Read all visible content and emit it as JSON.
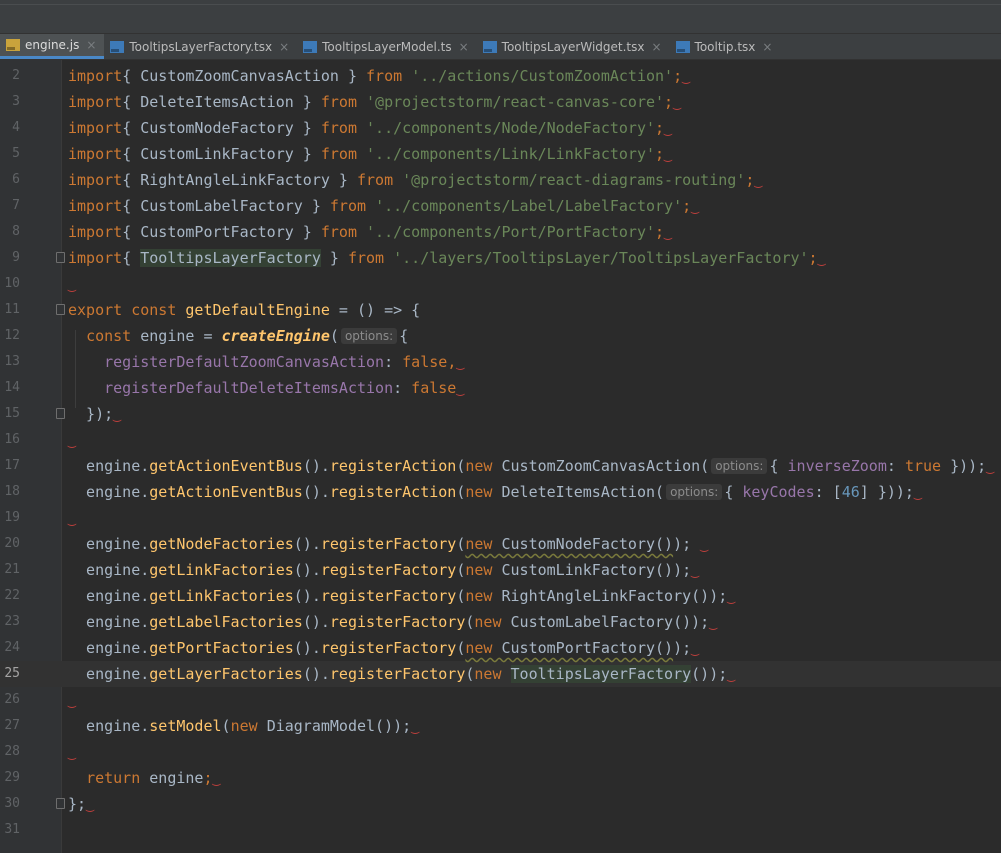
{
  "tabs": [
    {
      "label": "engine.js",
      "icon": "js-file-icon",
      "type": "js",
      "active": true
    },
    {
      "label": "TooltipsLayerFactory.tsx",
      "icon": "tsx-file-icon",
      "type": "tsx",
      "active": false
    },
    {
      "label": "TooltipsLayerModel.ts",
      "icon": "ts-file-icon",
      "type": "ts",
      "active": false
    },
    {
      "label": "TooltipsLayerWidget.tsx",
      "icon": "tsx-file-icon",
      "type": "tsx",
      "active": false
    },
    {
      "label": "Tooltip.tsx",
      "icon": "tsx-file-icon",
      "type": "tsx",
      "active": false
    }
  ],
  "tab_close_glyph": "×",
  "current_line": 25,
  "lines": [
    {
      "num": "2",
      "tokens": [
        [
          "k",
          "import"
        ],
        [
          "",
          "{ CustomZoomCanvasAction } "
        ],
        [
          "k",
          "from"
        ],
        [
          "",
          " "
        ],
        [
          "s",
          "'../actions/CustomZoomAction'"
        ],
        [
          "k",
          ";"
        ],
        [
          "sq",
          "‿"
        ]
      ]
    },
    {
      "num": "3",
      "tokens": [
        [
          "k",
          "import"
        ],
        [
          "",
          "{ DeleteItemsAction } "
        ],
        [
          "k",
          "from"
        ],
        [
          "",
          " "
        ],
        [
          "s",
          "'@projectstorm/react-canvas-core'"
        ],
        [
          "k",
          ";"
        ],
        [
          "sq",
          "‿"
        ]
      ]
    },
    {
      "num": "4",
      "tokens": [
        [
          "k",
          "import"
        ],
        [
          "",
          "{ CustomNodeFactory } "
        ],
        [
          "k",
          "from"
        ],
        [
          "",
          " "
        ],
        [
          "s",
          "'../components/Node/NodeFactory'"
        ],
        [
          "k",
          ";"
        ],
        [
          "sq",
          "‿"
        ]
      ]
    },
    {
      "num": "5",
      "tokens": [
        [
          "k",
          "import"
        ],
        [
          "",
          "{ CustomLinkFactory } "
        ],
        [
          "k",
          "from"
        ],
        [
          "",
          " "
        ],
        [
          "s",
          "'../components/Link/LinkFactory'"
        ],
        [
          "k",
          ";"
        ],
        [
          "sq",
          "‿"
        ]
      ]
    },
    {
      "num": "6",
      "tokens": [
        [
          "k",
          "import"
        ],
        [
          "",
          "{ RightAngleLinkFactory } "
        ],
        [
          "k",
          "from"
        ],
        [
          "",
          " "
        ],
        [
          "s",
          "'@projectstorm/react-diagrams-routing'"
        ],
        [
          "k",
          ";"
        ],
        [
          "sq",
          "‿"
        ]
      ]
    },
    {
      "num": "7",
      "tokens": [
        [
          "k",
          "import"
        ],
        [
          "",
          "{ CustomLabelFactory } "
        ],
        [
          "k",
          "from"
        ],
        [
          "",
          " "
        ],
        [
          "s",
          "'../components/Label/LabelFactory'"
        ],
        [
          "k",
          ";"
        ],
        [
          "sq",
          "‿"
        ]
      ]
    },
    {
      "num": "8",
      "tokens": [
        [
          "k",
          "import"
        ],
        [
          "",
          "{ CustomPortFactory } "
        ],
        [
          "k",
          "from"
        ],
        [
          "",
          " "
        ],
        [
          "s",
          "'../components/Port/PortFactory'"
        ],
        [
          "k",
          ";"
        ],
        [
          "sq",
          "‿"
        ]
      ]
    },
    {
      "num": "9",
      "tokens": [
        [
          "k",
          "import"
        ],
        [
          "",
          "{ "
        ],
        [
          "hlid",
          "TooltipsLayerFactory"
        ],
        [
          "",
          " } "
        ],
        [
          "k",
          "from"
        ],
        [
          "",
          " "
        ],
        [
          "s",
          "'../layers/TooltipsLayer/TooltipsLayerFactory'"
        ],
        [
          "k",
          ";"
        ],
        [
          "sq",
          "‿"
        ]
      ]
    },
    {
      "num": "10",
      "tokens": [
        [
          "sq",
          "‿"
        ]
      ]
    },
    {
      "num": "11",
      "tokens": [
        [
          "k",
          "export const "
        ],
        [
          "f",
          "getDefaultEngine"
        ],
        [
          "",
          " = () => {"
        ]
      ]
    },
    {
      "num": "12",
      "tokens": [
        [
          "",
          "  "
        ],
        [
          "k",
          "const "
        ],
        [
          "",
          "engine = "
        ],
        [
          "fi",
          "createEngine"
        ],
        [
          "",
          "("
        ],
        [
          "hint",
          "options:"
        ],
        [
          "",
          "{"
        ]
      ]
    },
    {
      "num": "13",
      "tokens": [
        [
          "",
          "    "
        ],
        [
          "p",
          "registerDefaultZoomCanvasAction"
        ],
        [
          "",
          ": "
        ],
        [
          "k",
          "false"
        ],
        [
          "k",
          ","
        ],
        [
          "sq",
          "‿"
        ]
      ]
    },
    {
      "num": "14",
      "tokens": [
        [
          "",
          "    "
        ],
        [
          "p",
          "registerDefaultDeleteItemsAction"
        ],
        [
          "",
          ": "
        ],
        [
          "k",
          "false"
        ],
        [
          "sq",
          "‿"
        ]
      ]
    },
    {
      "num": "15",
      "tokens": [
        [
          "",
          "  });"
        ],
        [
          "sq",
          "‿"
        ]
      ]
    },
    {
      "num": "16",
      "tokens": [
        [
          "sq",
          "‿"
        ]
      ]
    },
    {
      "num": "17",
      "tokens": [
        [
          "",
          "  engine."
        ],
        [
          "f",
          "getActionEventBus"
        ],
        [
          "",
          "()."
        ],
        [
          "f",
          "registerAction"
        ],
        [
          "",
          "("
        ],
        [
          "k",
          "new "
        ],
        [
          "",
          "CustomZoomCanvasAction("
        ],
        [
          "hint",
          "options:"
        ],
        [
          "",
          "{ "
        ],
        [
          "p",
          "inverseZoom"
        ],
        [
          "",
          ": "
        ],
        [
          "k",
          "true"
        ],
        [
          "",
          " }));"
        ],
        [
          "sq",
          "‿"
        ]
      ]
    },
    {
      "num": "18",
      "tokens": [
        [
          "",
          "  engine."
        ],
        [
          "f",
          "getActionEventBus"
        ],
        [
          "",
          "()."
        ],
        [
          "f",
          "registerAction"
        ],
        [
          "",
          "("
        ],
        [
          "k",
          "new "
        ],
        [
          "",
          "DeleteItemsAction("
        ],
        [
          "hint",
          "options:"
        ],
        [
          "",
          "{ "
        ],
        [
          "p",
          "keyCodes"
        ],
        [
          "",
          ": ["
        ],
        [
          "n",
          "46"
        ],
        [
          "",
          "] }));"
        ],
        [
          "sq",
          "‿"
        ]
      ]
    },
    {
      "num": "19",
      "tokens": [
        [
          "sq",
          "‿"
        ]
      ]
    },
    {
      "num": "20",
      "tokens": [
        [
          "",
          "  engine."
        ],
        [
          "f",
          "getNodeFactories"
        ],
        [
          "",
          "()."
        ],
        [
          "f",
          "registerFactory"
        ],
        [
          "",
          "("
        ],
        [
          "uwk",
          "new "
        ],
        [
          "uw",
          "CustomNodeFactory()"
        ],
        [
          "",
          "); "
        ],
        [
          "sq",
          "‿"
        ]
      ]
    },
    {
      "num": "21",
      "tokens": [
        [
          "",
          "  engine."
        ],
        [
          "f",
          "getLinkFactories"
        ],
        [
          "",
          "()."
        ],
        [
          "f",
          "registerFactory"
        ],
        [
          "",
          "("
        ],
        [
          "k",
          "new "
        ],
        [
          "",
          "CustomLinkFactory());"
        ],
        [
          "sq",
          "‿"
        ]
      ]
    },
    {
      "num": "22",
      "tokens": [
        [
          "",
          "  engine."
        ],
        [
          "f",
          "getLinkFactories"
        ],
        [
          "",
          "()."
        ],
        [
          "f",
          "registerFactory"
        ],
        [
          "",
          "("
        ],
        [
          "k",
          "new "
        ],
        [
          "",
          "RightAngleLinkFactory());"
        ],
        [
          "sq",
          "‿"
        ]
      ]
    },
    {
      "num": "23",
      "tokens": [
        [
          "",
          "  engine."
        ],
        [
          "f",
          "getLabelFactories"
        ],
        [
          "",
          "()."
        ],
        [
          "f",
          "registerFactory"
        ],
        [
          "",
          "("
        ],
        [
          "k",
          "new "
        ],
        [
          "",
          "CustomLabelFactory());"
        ],
        [
          "sq",
          "‿"
        ]
      ]
    },
    {
      "num": "24",
      "tokens": [
        [
          "",
          "  engine."
        ],
        [
          "f",
          "getPortFactories"
        ],
        [
          "",
          "()."
        ],
        [
          "f",
          "registerFactory"
        ],
        [
          "",
          "("
        ],
        [
          "uwk",
          "new "
        ],
        [
          "uw",
          "CustomPortFactory()"
        ],
        [
          "",
          ");"
        ],
        [
          "sq",
          "‿"
        ]
      ]
    },
    {
      "num": "25",
      "tokens": [
        [
          "",
          "  engine."
        ],
        [
          "f",
          "getLayerFactories"
        ],
        [
          "",
          "()."
        ],
        [
          "f",
          "registerFactory"
        ],
        [
          "",
          "("
        ],
        [
          "k",
          "new "
        ],
        [
          "hlid",
          "TooltipsLayerFactory"
        ],
        [
          "",
          "());"
        ],
        [
          "sq",
          "‿"
        ]
      ]
    },
    {
      "num": "26",
      "tokens": [
        [
          "sq",
          "‿"
        ]
      ]
    },
    {
      "num": "27",
      "tokens": [
        [
          "",
          "  engine."
        ],
        [
          "f",
          "setModel"
        ],
        [
          "",
          "("
        ],
        [
          "k",
          "new "
        ],
        [
          "",
          "DiagramModel());"
        ],
        [
          "sq",
          "‿"
        ]
      ]
    },
    {
      "num": "28",
      "tokens": [
        [
          "sq",
          "‿"
        ]
      ]
    },
    {
      "num": "29",
      "tokens": [
        [
          "",
          "  "
        ],
        [
          "k",
          "return "
        ],
        [
          "",
          "engine"
        ],
        [
          "k",
          ";"
        ],
        [
          "sq",
          "‿"
        ]
      ]
    },
    {
      "num": "30",
      "tokens": [
        [
          "",
          "};"
        ],
        [
          "sq",
          "‿"
        ]
      ]
    },
    {
      "num": "31",
      "tokens": []
    }
  ],
  "colors": {
    "background": "#2b2b2b",
    "keyword": "#cc7832",
    "string": "#6a8759",
    "function": "#ffc66d",
    "property": "#9876aa",
    "number": "#6897bb",
    "identifier": "#a9b7c6",
    "active_tab_underline": "#4a88c7"
  }
}
